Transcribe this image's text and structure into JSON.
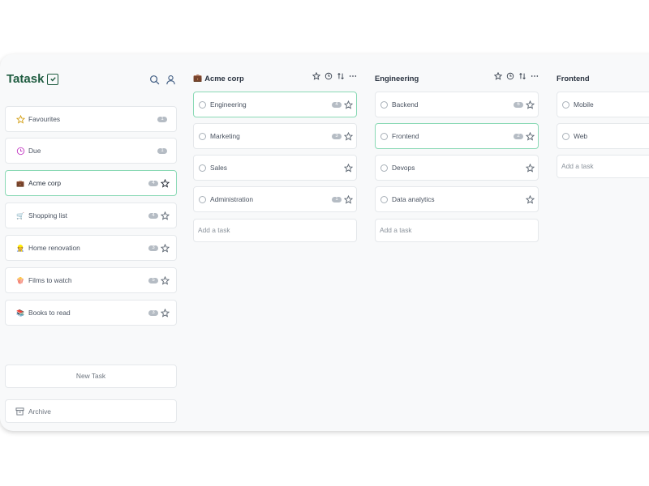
{
  "app": {
    "name": "Tatask",
    "accent": "#1f5c40",
    "active_border": "#8ad9b5"
  },
  "sidebar": {
    "items": [
      {
        "label": "Favourites",
        "icon": "star-outline-icon",
        "badge": "1",
        "starrable": false
      },
      {
        "label": "Due",
        "icon": "clock-icon",
        "badge": "1",
        "starrable": false
      },
      {
        "label": "Acme corp",
        "icon": "briefcase-emoji",
        "badge": "4",
        "starrable": true,
        "active": true
      },
      {
        "label": "Shopping list",
        "icon": "cart-emoji",
        "badge": "4",
        "starrable": true
      },
      {
        "label": "Home renovation",
        "icon": "worker-emoji",
        "badge": "3",
        "starrable": true
      },
      {
        "label": "Films to watch",
        "icon": "popcorn-emoji",
        "badge": "5",
        "starrable": true
      },
      {
        "label": "Books to read",
        "icon": "books-emoji",
        "badge": "3",
        "starrable": true
      }
    ],
    "new_task_label": "New Task",
    "archive_label": "Archive"
  },
  "columns": [
    {
      "title": "Acme corp",
      "emoji": "💼",
      "tasks": [
        {
          "label": "Engineering",
          "badge": "4",
          "active": true
        },
        {
          "label": "Marketing",
          "badge": "3"
        },
        {
          "label": "Sales",
          "badge": ""
        },
        {
          "label": "Administration",
          "badge": "1"
        }
      ],
      "add_task_label": "Add a task"
    },
    {
      "title": "Engineering",
      "emoji": "",
      "tasks": [
        {
          "label": "Backend",
          "badge": "6"
        },
        {
          "label": "Frontend",
          "badge": "2",
          "active": true
        },
        {
          "label": "Devops",
          "badge": ""
        },
        {
          "label": "Data analytics",
          "badge": ""
        }
      ],
      "add_task_label": "Add a task"
    },
    {
      "title": "Frontend",
      "emoji": "",
      "tasks": [
        {
          "label": "Mobile",
          "badge": ""
        },
        {
          "label": "Web",
          "badge": ""
        }
      ],
      "add_task_label": "Add a task"
    }
  ]
}
